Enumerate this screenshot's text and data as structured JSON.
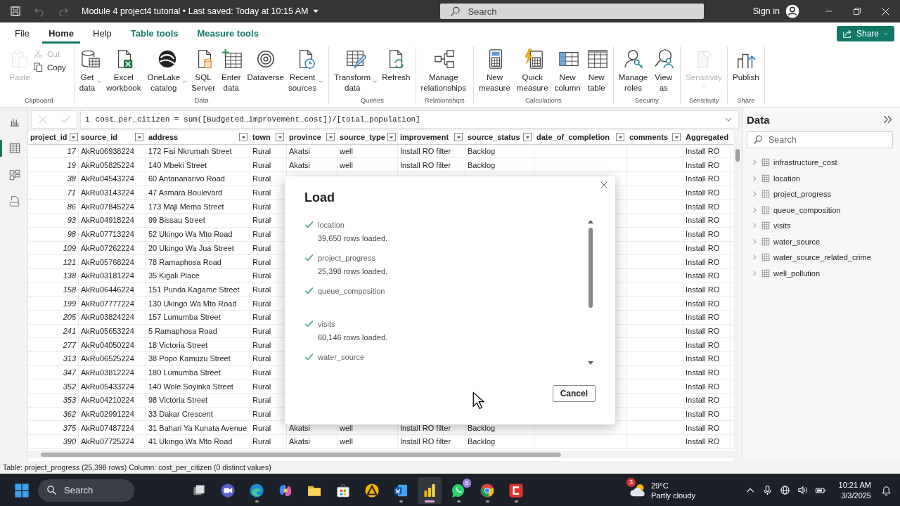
{
  "title_bar": {
    "title": "Module 4 project4 tutorial • Last saved: Today at 10:15 AM",
    "search": {
      "placeholder": "Search"
    },
    "sign_in": "Sign in"
  },
  "menu_tabs": [
    {
      "label": "File",
      "selected": false,
      "kind": "plain"
    },
    {
      "label": "Home",
      "selected": true,
      "kind": "plain"
    },
    {
      "label": "Help",
      "selected": false,
      "kind": "plain"
    },
    {
      "label": "Table tools",
      "selected": false,
      "kind": "contextual"
    },
    {
      "label": "Measure tools",
      "selected": false,
      "kind": "contextual"
    }
  ],
  "share_button": {
    "label": "Share"
  },
  "ribbon": {
    "groups": [
      {
        "label": "Clipboard",
        "buttons": [
          {
            "label": "Paste",
            "kind": "large",
            "disabled": true,
            "dropdown": false
          },
          {
            "label": "Cut",
            "kind": "small",
            "disabled": true,
            "dropdown": false
          },
          {
            "label": "Copy",
            "kind": "small",
            "disabled": false,
            "dropdown": false
          }
        ]
      },
      {
        "label": "Data",
        "buttons": [
          {
            "label": "Get\ndata",
            "kind": "large",
            "disabled": false,
            "dropdown": true
          },
          {
            "label": "Excel\nworkbook",
            "kind": "large",
            "disabled": false,
            "dropdown": false
          },
          {
            "label": "OneLake\ncatalog",
            "kind": "large",
            "disabled": false,
            "dropdown": true
          },
          {
            "label": "SQL\nServer",
            "kind": "large",
            "disabled": false,
            "dropdown": false
          },
          {
            "label": "Enter\ndata",
            "kind": "large",
            "disabled": false,
            "dropdown": false
          },
          {
            "label": "Dataverse",
            "kind": "large",
            "disabled": false,
            "dropdown": false
          },
          {
            "label": "Recent\nsources",
            "kind": "large",
            "disabled": false,
            "dropdown": true
          }
        ]
      },
      {
        "label": "Queries",
        "buttons": [
          {
            "label": "Transform\ndata",
            "kind": "large",
            "disabled": false,
            "dropdown": true
          },
          {
            "label": "Refresh",
            "kind": "large",
            "disabled": false,
            "dropdown": false
          }
        ]
      },
      {
        "label": "Relationships",
        "buttons": [
          {
            "label": "Manage\nrelationships",
            "kind": "large",
            "disabled": false,
            "dropdown": false
          }
        ]
      },
      {
        "label": "Calculations",
        "buttons": [
          {
            "label": "New\nmeasure",
            "kind": "large",
            "disabled": false,
            "dropdown": false
          },
          {
            "label": "Quick\nmeasure",
            "kind": "large",
            "disabled": false,
            "dropdown": false
          },
          {
            "label": "New\ncolumn",
            "kind": "large",
            "disabled": false,
            "dropdown": false
          },
          {
            "label": "New\ntable",
            "kind": "large",
            "disabled": false,
            "dropdown": false
          }
        ]
      },
      {
        "label": "Security",
        "buttons": [
          {
            "label": "Manage\nroles",
            "kind": "large",
            "disabled": false,
            "dropdown": false
          },
          {
            "label": "View\nas",
            "kind": "large",
            "disabled": false,
            "dropdown": false
          }
        ]
      },
      {
        "label": "Sensitivity",
        "buttons": [
          {
            "label": "Sensitivity",
            "kind": "large",
            "disabled": true,
            "dropdown": true
          }
        ]
      },
      {
        "label": "Share",
        "buttons": [
          {
            "label": "Publish",
            "kind": "large",
            "disabled": false,
            "dropdown": false
          }
        ]
      }
    ]
  },
  "view_rail": [
    {
      "selected": false
    },
    {
      "selected": true
    },
    {
      "selected": false
    },
    {
      "selected": false
    }
  ],
  "formula_bar": {
    "line": "1",
    "text": "cost_per_citizen = sum([Budgeted_improvement_cost])/[total_population]"
  },
  "table": {
    "columns": [
      {
        "label": "project_id"
      },
      {
        "label": "source_id"
      },
      {
        "label": "address"
      },
      {
        "label": "town"
      },
      {
        "label": "province"
      },
      {
        "label": "source_type"
      },
      {
        "label": "improvement"
      },
      {
        "label": "source_status"
      },
      {
        "label": "date_of_completion"
      },
      {
        "label": "comments"
      },
      {
        "label": "Aggregated"
      }
    ],
    "rows": [
      [
        "17",
        "AkRu06938224",
        "172 Fisi Nkrumah Street",
        "Rural",
        "Akatsi",
        "well",
        "Install RO filter",
        "Backlog",
        null,
        null,
        "Install RO"
      ],
      [
        "19",
        "AkRu05825224",
        "140 Mbeki Street",
        "Rural",
        "Akatsi",
        "well",
        "Install RO filter",
        "Backlog",
        null,
        null,
        "Install RO"
      ],
      [
        "38",
        "AkRu04543224",
        "60 Antananarivo Road",
        "Rural",
        null,
        null,
        null,
        null,
        null,
        null,
        "Install RO"
      ],
      [
        "71",
        "AkRu03143224",
        "47 Asmara Boulevard",
        "Rural",
        null,
        null,
        null,
        null,
        null,
        null,
        "Install RO"
      ],
      [
        "86",
        "AkRu07845224",
        "173 Maji Mema Street",
        "Rural",
        null,
        null,
        null,
        null,
        null,
        null,
        "Install RO"
      ],
      [
        "93",
        "AkRu04918224",
        "99 Bissau Street",
        "Rural",
        null,
        null,
        null,
        null,
        null,
        null,
        "Install RO"
      ],
      [
        "98",
        "AkRu07713224",
        "52 Ukingo Wa Mto Road",
        "Rural",
        null,
        null,
        null,
        null,
        null,
        null,
        "Install RO"
      ],
      [
        "109",
        "AkRu07262224",
        "20 Ukingo Wa Jua Street",
        "Rural",
        null,
        null,
        null,
        null,
        null,
        null,
        "Install RO"
      ],
      [
        "121",
        "AkRu05768224",
        "78 Ramaphosa Road",
        "Rural",
        null,
        null,
        null,
        null,
        null,
        null,
        "Install RO"
      ],
      [
        "138",
        "AkRu03181224",
        "35 Kigali Place",
        "Rural",
        null,
        null,
        null,
        null,
        null,
        null,
        "Install RO"
      ],
      [
        "158",
        "AkRu06446224",
        "151 Punda Kagame Street",
        "Rural",
        null,
        null,
        null,
        null,
        null,
        null,
        "Install RO"
      ],
      [
        "199",
        "AkRu07777224",
        "130 Ukingo Wa Mto Road",
        "Rural",
        null,
        null,
        null,
        null,
        null,
        null,
        "Install RO"
      ],
      [
        "205",
        "AkRu03824224",
        "157 Lumumba Street",
        "Rural",
        null,
        null,
        null,
        null,
        null,
        null,
        "Install RO"
      ],
      [
        "241",
        "AkRu05653224",
        "5 Ramaphosa Road",
        "Rural",
        null,
        null,
        null,
        null,
        null,
        null,
        "Install RO"
      ],
      [
        "277",
        "AkRu04050224",
        "18 Victoria Street",
        "Rural",
        null,
        null,
        null,
        null,
        null,
        null,
        "Install RO"
      ],
      [
        "313",
        "AkRu06525224",
        "38 Popo Kamuzu Street",
        "Rural",
        null,
        null,
        null,
        null,
        null,
        null,
        "Install RO"
      ],
      [
        "347",
        "AkRu03812224",
        "180 Lumumba Street",
        "Rural",
        null,
        null,
        null,
        null,
        null,
        null,
        "Install RO"
      ],
      [
        "352",
        "AkRu05433224",
        "140 Wole Soyinka Street",
        "Rural",
        null,
        null,
        null,
        null,
        null,
        null,
        "Install RO"
      ],
      [
        "353",
        "AkRu04210224",
        "98 Victoria Street",
        "Rural",
        null,
        null,
        null,
        null,
        null,
        null,
        "Install RO"
      ],
      [
        "362",
        "AkRu02991224",
        "33 Dakar Crescent",
        "Rural",
        null,
        null,
        null,
        null,
        null,
        null,
        "Install RO"
      ],
      [
        "375",
        "AkRu07487224",
        "31 Bahari Ya Kunata Avenue",
        "Rural",
        "Akatsi",
        "well",
        "Install RO filter",
        "Backlog",
        null,
        null,
        "Install RO"
      ],
      [
        "390",
        "AkRu07725224",
        "41 Ukingo Wa Mto Road",
        "Rural",
        "Akatsi",
        "well",
        "Install RO filter",
        "Backlog",
        null,
        null,
        "Install RO"
      ]
    ]
  },
  "data_pane": {
    "title": "Data",
    "search": {
      "placeholder": "Search"
    },
    "tables": [
      {
        "name": "infrastructure_cost",
        "expanded": false
      },
      {
        "name": "location",
        "expanded": false
      },
      {
        "name": "project_progress",
        "expanded": false
      },
      {
        "name": "queue_composition",
        "expanded": false
      },
      {
        "name": "visits",
        "expanded": false
      },
      {
        "name": "water_source",
        "expanded": false
      },
      {
        "name": "water_source_related_crime",
        "expanded": false
      },
      {
        "name": "well_pollution",
        "expanded": false
      }
    ]
  },
  "dialog": {
    "title": "Load",
    "items": [
      {
        "name": "location",
        "detail": "39,650 rows loaded.",
        "done": true
      },
      {
        "name": "project_progress",
        "detail": "25,398 rows loaded.",
        "done": true
      },
      {
        "name": "queue_composition",
        "done": true
      },
      {
        "name": "visits",
        "detail": "60,146 rows loaded.",
        "done": true
      },
      {
        "name": "water_source",
        "done": true
      }
    ],
    "cancel": "Cancel"
  },
  "status_bar": {
    "text": "Table: project_progress (25,398 rows) Column: cost_per_citizen (0 distinct values)"
  },
  "taskbar": {
    "search": {
      "placeholder": "Search"
    },
    "apps": [
      {
        "running": false,
        "selected": false
      },
      {
        "running": false,
        "selected": false
      },
      {
        "running": true,
        "selected": false
      },
      {
        "running": false,
        "selected": false
      },
      {
        "running": false,
        "selected": false
      },
      {
        "running": false,
        "selected": false
      },
      {
        "running": false,
        "selected": false
      },
      {
        "running": true,
        "selected": false
      },
      {
        "running": true,
        "selected": true
      },
      {
        "running": true,
        "selected": false,
        "badge": "8"
      },
      {
        "running": true,
        "selected": false
      },
      {
        "running": true,
        "selected": false
      }
    ],
    "weather": {
      "badge": "3",
      "temperature": "29°C",
      "condition": "Partly cloudy"
    },
    "clock": {
      "time": "10:21 AM",
      "date": "3/3/2025"
    }
  }
}
